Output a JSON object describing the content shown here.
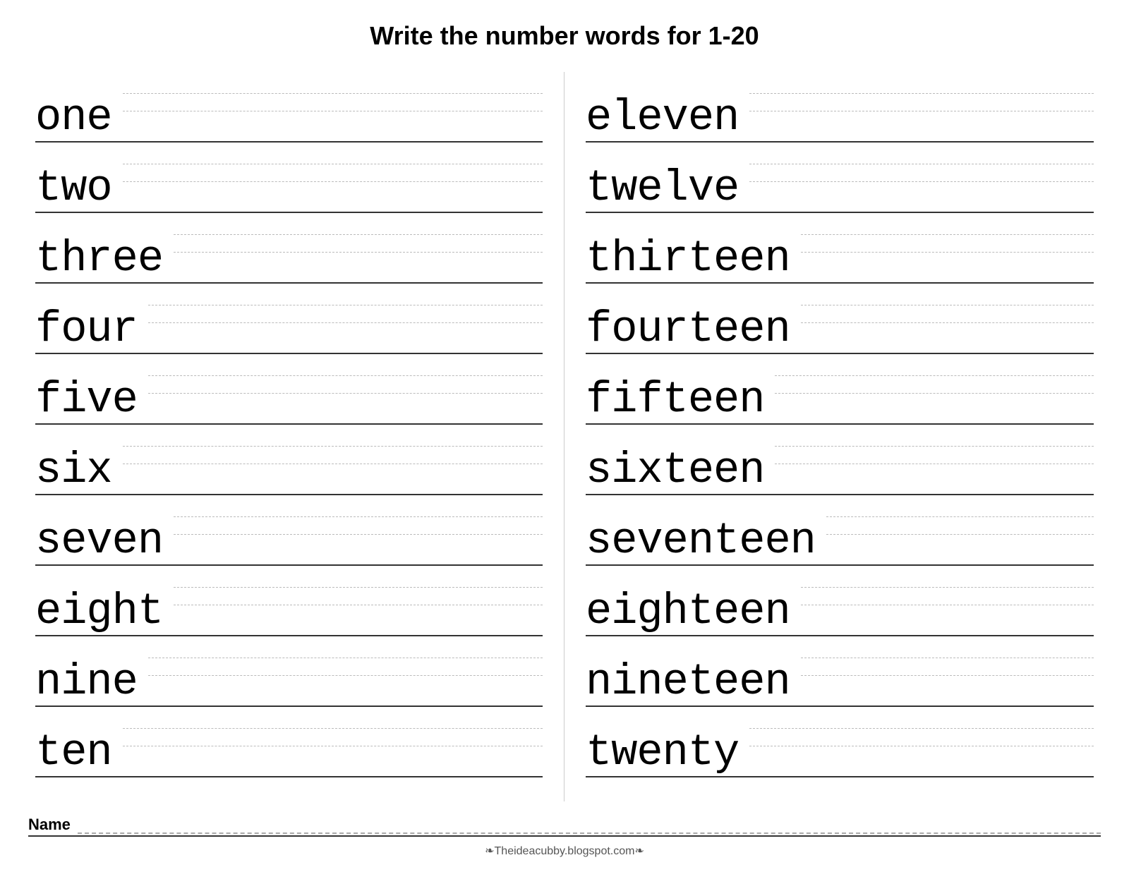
{
  "title": "Write the number words for  1-20",
  "left_words": [
    "one",
    "two",
    "three",
    "four",
    "five",
    "six",
    "seven",
    "eight",
    "nine",
    "ten"
  ],
  "right_words": [
    "eleven",
    "twelve",
    "thirteen",
    "fourteen",
    "fifteen",
    "sixteen",
    "seventeen",
    "eighteen",
    "nineteen",
    "twenty"
  ],
  "name_label": "Name",
  "footer": "❧Theideacubby.blogspot.com❧"
}
